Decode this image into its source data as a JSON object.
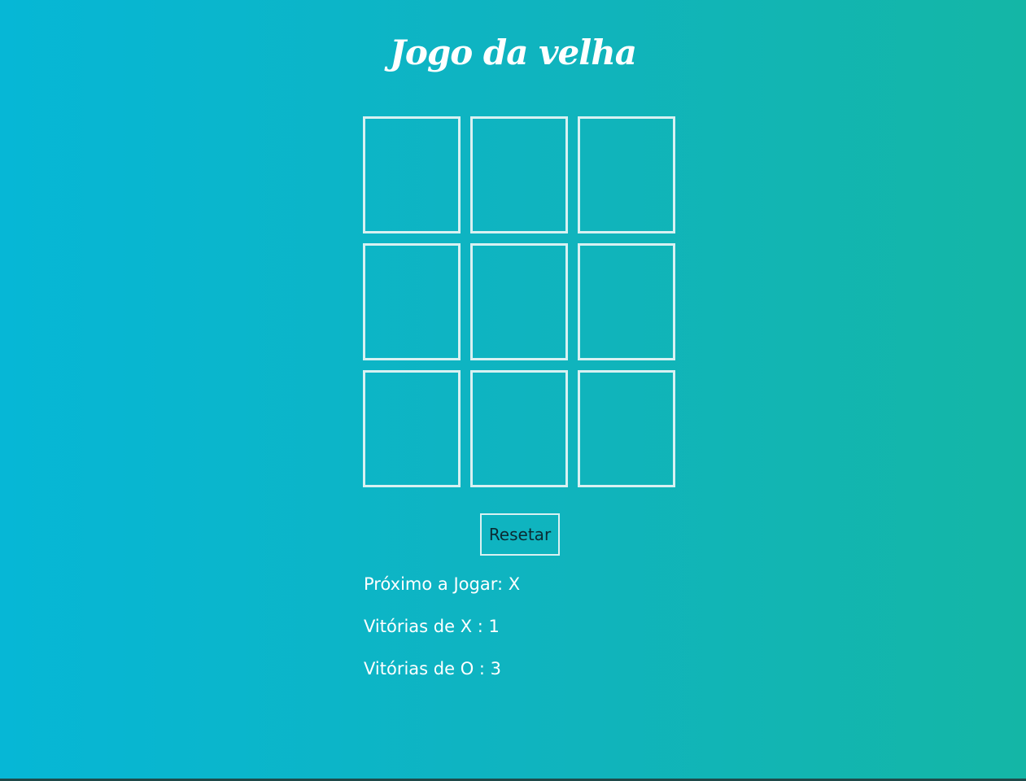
{
  "title": "Jogo da velha",
  "board": {
    "cells": [
      "",
      "",
      "",
      "",
      "",
      "",
      "",
      "",
      ""
    ]
  },
  "reset_label": "Resetar",
  "status": {
    "next_player": "Próximo a Jogar: X",
    "wins_x": "Vitórias de X : 1",
    "wins_o": "Vitórias de O : 3"
  },
  "colors": {
    "gradient_start": "#06b7d6",
    "gradient_end": "#14b6a6",
    "cell_border": "#d8f1f2",
    "text": "#ffffff"
  }
}
